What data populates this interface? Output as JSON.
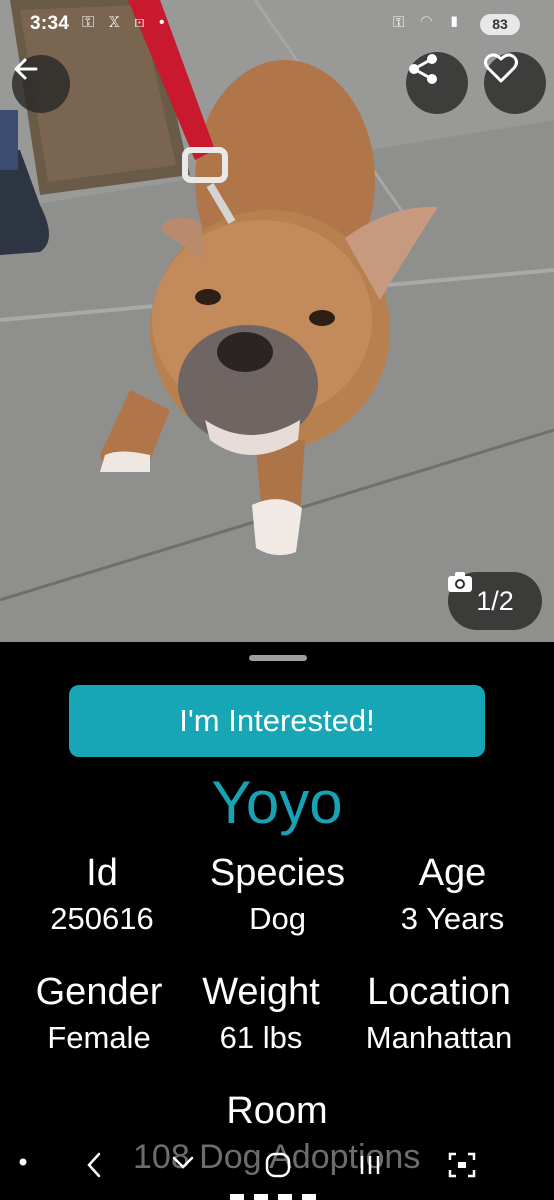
{
  "status_bar": {
    "time": "3:34",
    "battery": "83"
  },
  "photo": {
    "counter": "1/2"
  },
  "actions": {
    "interest_label": "I'm Interested!"
  },
  "pet": {
    "name": "Yoyo",
    "fields": [
      {
        "label": "Id",
        "value": "250616"
      },
      {
        "label": "Species",
        "value": "Dog"
      },
      {
        "label": "Age",
        "value": "3 Years"
      },
      {
        "label": "Gender",
        "value": "Female"
      },
      {
        "label": "Weight",
        "value": "61 lbs"
      },
      {
        "label": "Location",
        "value": "Manhattan"
      },
      {
        "label": "Room",
        "value": "108 Dog Adoptions"
      }
    ]
  },
  "colors": {
    "accent": "#16a6b6",
    "name": "#17a3b3",
    "background": "#000000"
  }
}
